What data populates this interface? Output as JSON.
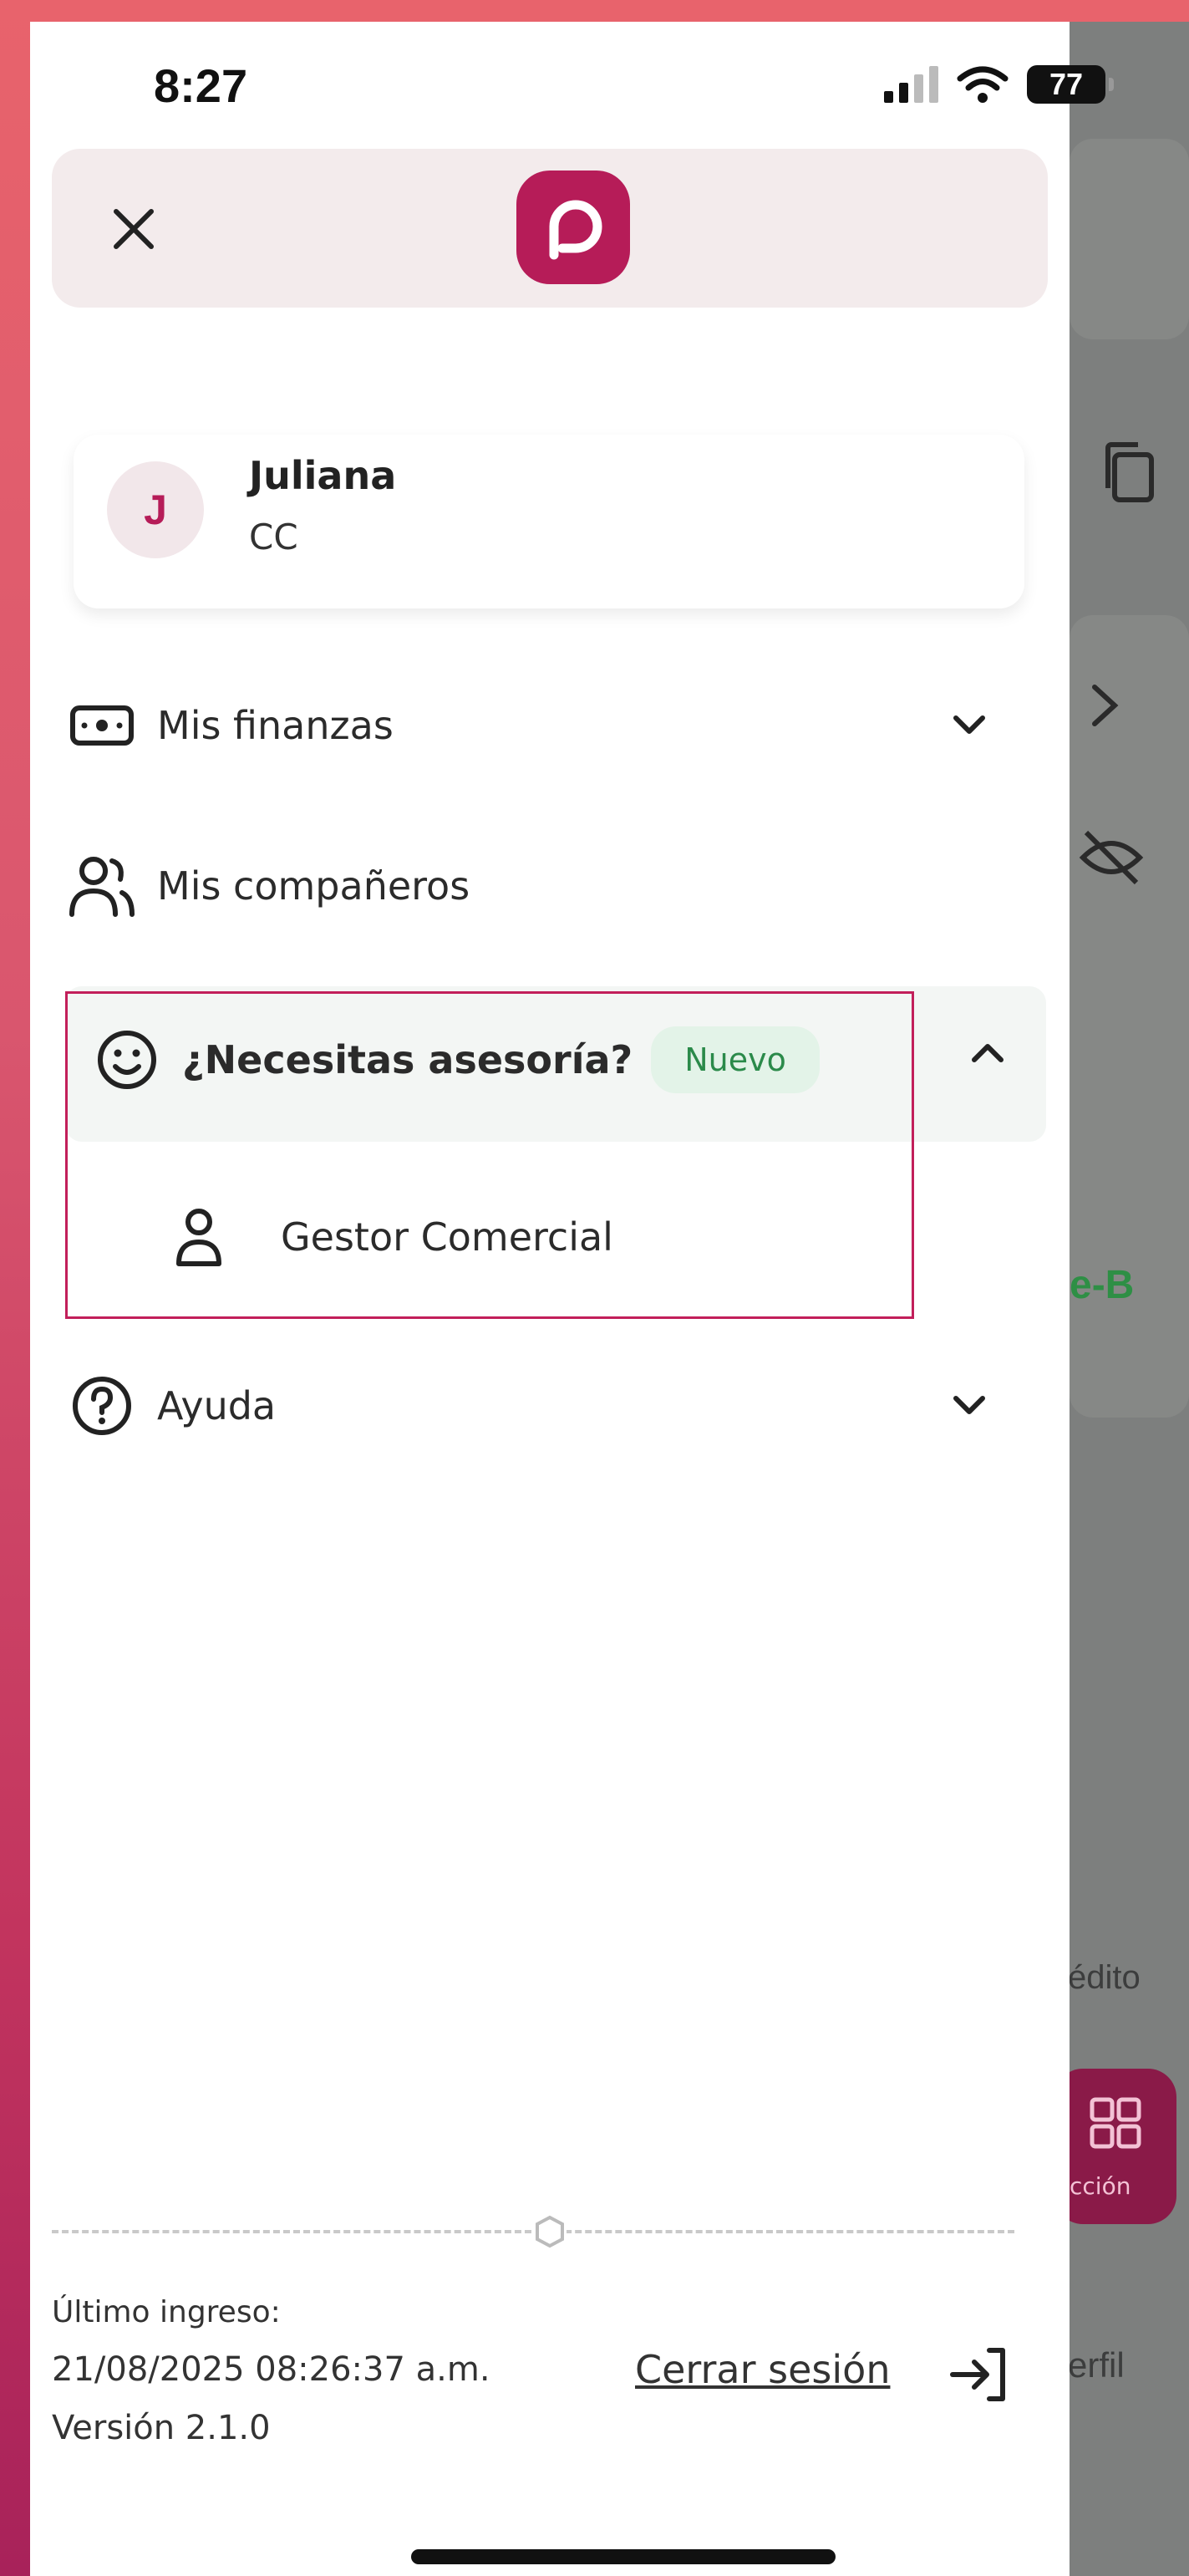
{
  "status_bar": {
    "time": "8:27",
    "battery": "77"
  },
  "header": {
    "close_icon": "close-icon",
    "logo_icon": "brand-p-logo"
  },
  "user": {
    "initial": "J",
    "name": "Juliana",
    "document_type": "CC"
  },
  "menu": {
    "finanzas": {
      "label": "Mis finanzas",
      "icon": "money-bill-icon"
    },
    "companeros": {
      "label": "Mis compañeros",
      "icon": "users-icon"
    },
    "asesoria": {
      "label": "¿Necesitas asesoría?",
      "badge": "Nuevo",
      "icon": "smile-icon",
      "sub_item": "Gestor Comercial"
    },
    "ayuda": {
      "label": "Ayuda",
      "icon": "help-circle-icon"
    }
  },
  "footer": {
    "last_login_label": "Último ingreso:",
    "last_login_value": "21/08/2025 08:26:37 a.m.",
    "version": "Versión 2.1.0",
    "logout_label": "Cerrar sesión"
  },
  "background": {
    "text_green": "e-B",
    "text_credito": "édito",
    "text_accion": "cción",
    "text_perfil": "erfil"
  },
  "colors": {
    "brand": "#b61c58",
    "highlight_border": "#c21f5a",
    "badge_bg": "#e3f3e8",
    "badge_text": "#2b8a4a"
  }
}
